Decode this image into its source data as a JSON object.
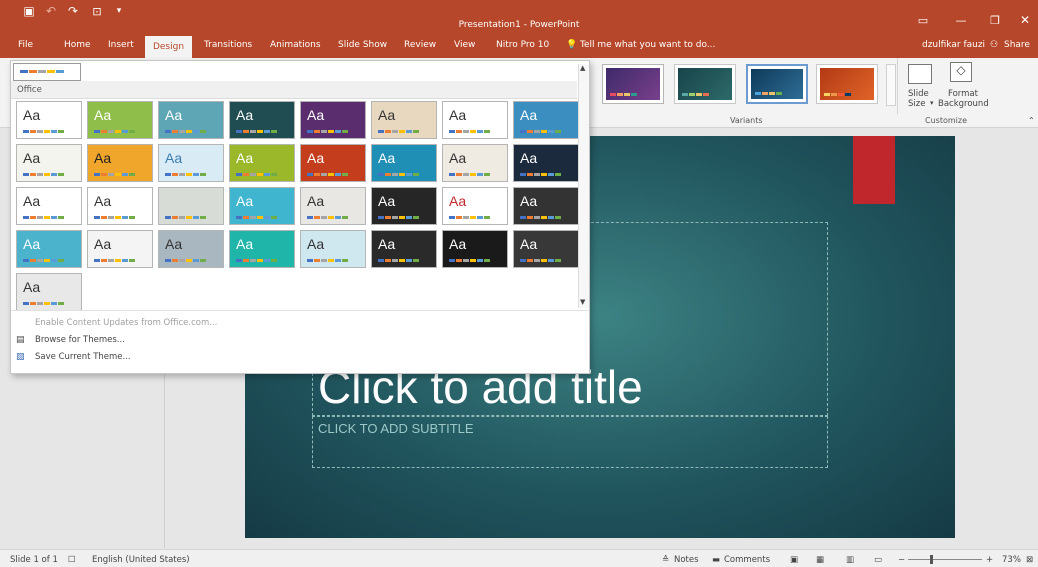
{
  "window": {
    "title": "Presentation1 - PowerPoint",
    "user": "dzulfikar fauzi",
    "share": "Share"
  },
  "tabs": [
    "File",
    "Home",
    "Insert",
    "Design",
    "Transitions",
    "Animations",
    "Slide Show",
    "Review",
    "View",
    "Nitro Pro 10"
  ],
  "tell_me": "Tell me what you want to do...",
  "ribbon": {
    "variants_label": "Variants",
    "customize_label": "Customize",
    "slide_size": "Slide",
    "slide_size_2": "Size",
    "format_bg": "Format",
    "format_bg_2": "Background"
  },
  "theme_panel": {
    "section": "Office",
    "rows": [
      [
        {
          "bg": "#ffffff",
          "fg": "#333333",
          "aa": "Aa"
        },
        {
          "bg": "#8fbe4a",
          "fg": "#ffffff",
          "aa": "Aa"
        },
        {
          "bg": "#5ea6b5",
          "fg": "#ffffff",
          "aa": "Aa"
        },
        {
          "bg": "#1f4d52",
          "fg": "#ffffff",
          "aa": "Aa"
        },
        {
          "bg": "#5a2d6e",
          "fg": "#ffffff",
          "aa": "Aa"
        },
        {
          "bg": "#e8d8c0",
          "fg": "#333333",
          "aa": "Aa"
        },
        {
          "bg": "#ffffff",
          "fg": "#333333",
          "aa": "Aa"
        },
        {
          "bg": "#3a8fc0",
          "fg": "#ffffff",
          "aa": "Aa"
        }
      ],
      [
        {
          "bg": "#f4f4ee",
          "fg": "#333333",
          "aa": "Aa"
        },
        {
          "bg": "#f0a62a",
          "fg": "#222222",
          "aa": "Aa"
        },
        {
          "bg": "#d9ecf6",
          "fg": "#3a7db0",
          "aa": "Aa"
        },
        {
          "bg": "#9ab82a",
          "fg": "#ffffff",
          "aa": "Aa"
        },
        {
          "bg": "#c43d1c",
          "fg": "#ffffff",
          "aa": "Aa"
        },
        {
          "bg": "#1f8fb5",
          "fg": "#ffffff",
          "aa": "Aa"
        },
        {
          "bg": "#efeae2",
          "fg": "#333333",
          "aa": "Aa"
        },
        {
          "bg": "#1b2a3c",
          "fg": "#ffffff",
          "aa": "Aa"
        }
      ],
      [
        {
          "bg": "#ffffff",
          "fg": "#333333",
          "aa": "Aa"
        },
        {
          "bg": "#ffffff",
          "fg": "#333333",
          "aa": "Aa"
        },
        {
          "bg": "#d8dcd6",
          "fg": "#333333",
          "aa": ""
        },
        {
          "bg": "#3fb5cf",
          "fg": "#ffffff",
          "aa": "Aa"
        },
        {
          "bg": "#e9e7e4",
          "fg": "#333333",
          "aa": "Aa"
        },
        {
          "bg": "#262626",
          "fg": "#ffffff",
          "aa": "Aa"
        },
        {
          "bg": "#ffffff",
          "fg": "#c0282d",
          "aa": "Aa"
        },
        {
          "bg": "#333333",
          "fg": "#ffffff",
          "aa": "Aa"
        }
      ],
      [
        {
          "bg": "#4bb3cc",
          "fg": "#ffffff",
          "aa": "Aa"
        },
        {
          "bg": "#f4f4f4",
          "fg": "#333333",
          "aa": "Aa"
        },
        {
          "bg": "#a9b8c0",
          "fg": "#333333",
          "aa": "Aa"
        },
        {
          "bg": "#1fb5a8",
          "fg": "#ffffff",
          "aa": "Aa"
        },
        {
          "bg": "#cfe7ef",
          "fg": "#333333",
          "aa": "Aa"
        },
        {
          "bg": "#2a2a2a",
          "fg": "#ffffff",
          "aa": "Aa"
        },
        {
          "bg": "#1a1a1a",
          "fg": "#ffffff",
          "aa": "Aa"
        },
        {
          "bg": "#383838",
          "fg": "#ffffff",
          "aa": "Aa"
        }
      ],
      [
        {
          "bg": "#e8e8e8",
          "fg": "#333333",
          "aa": "Aa"
        }
      ]
    ],
    "menu": [
      "Enable Content Updates from Office.com...",
      "Browse for Themes...",
      "Save Current Theme..."
    ]
  },
  "slide": {
    "title": "Click to add title",
    "subtitle": "CLICK TO ADD SUBTITLE"
  },
  "status": {
    "slide": "Slide 1 of 1",
    "language": "English (United States)",
    "notes": "Notes",
    "comments": "Comments",
    "zoom": "73%"
  },
  "colors": {
    "accent": "#b7472a",
    "slide_bg": "#21565e"
  }
}
